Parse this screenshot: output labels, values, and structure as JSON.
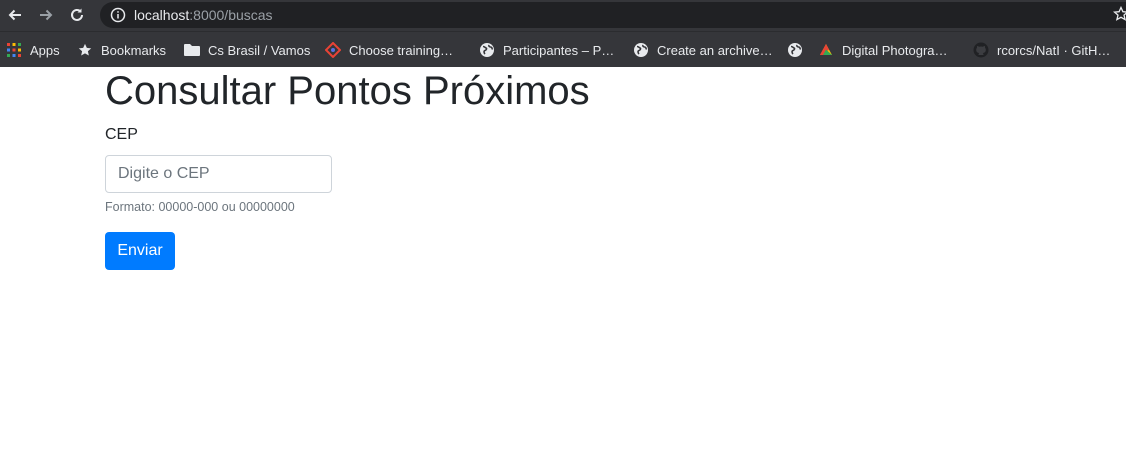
{
  "browser": {
    "url_host": "localhost",
    "url_rest": ":8000/buscas",
    "icons": {
      "back": "back-arrow-icon",
      "forward": "forward-arrow-icon",
      "reload": "reload-icon",
      "info": "info-icon",
      "star": "star-icon"
    }
  },
  "bookmarks": [
    {
      "label": "Apps",
      "icon": "apps-grid-icon"
    },
    {
      "label": "Bookmarks",
      "icon": "star-icon"
    },
    {
      "label": "Cs Brasil / Vamos",
      "icon": "folder-icon"
    },
    {
      "label": "Choose training…",
      "icon": "site-favicon"
    },
    {
      "label": "Participantes – P…",
      "icon": "globe-icon"
    },
    {
      "label": "Create an archive…",
      "icon": "globe-icon"
    },
    {
      "label": "",
      "icon": "globe-icon"
    },
    {
      "label": "Digital Photogra…",
      "icon": "site-favicon"
    },
    {
      "label": "rcorcs/NatI · GitH…",
      "icon": "github-icon"
    }
  ],
  "page": {
    "title": "Consultar Pontos Próximos",
    "cep_label": "CEP",
    "cep_placeholder": "Digite o CEP",
    "cep_value": "",
    "hint": "Formato: 00000-000 ou 00000000",
    "submit_label": "Enviar"
  },
  "colors": {
    "toolbar_bg": "#35363a",
    "omnibox_bg": "#202124",
    "primary_button": "#007bff",
    "text": "#212529",
    "muted_text": "#6c757d"
  }
}
